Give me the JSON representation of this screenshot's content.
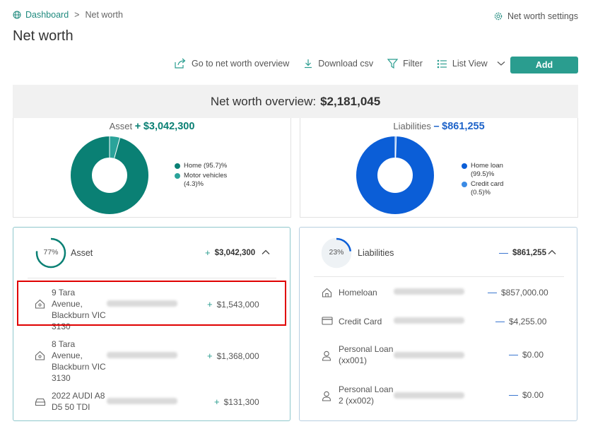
{
  "breadcrumb": {
    "root": "Dashboard",
    "separator": ">",
    "current": "Net worth"
  },
  "header": {
    "title": "Net worth",
    "settings_label": "Net worth settings"
  },
  "toolbar": {
    "overview_label": "Go to net worth overview",
    "download_label": "Download csv",
    "filter_label": "Filter",
    "view_label": "List View",
    "add_label": "Add"
  },
  "overview": {
    "label": "Net worth overview:",
    "value": "$2,181,045"
  },
  "colors": {
    "teal": "#0a8074",
    "teal_light": "#2aa39a",
    "blue": "#0b5ed7",
    "blue_light": "#3b8be5",
    "accent": "#2a9d8f"
  },
  "asset_chart": {
    "label": "Asset",
    "sign": "+",
    "amount": "$3,042,300",
    "legend": [
      "Home (95.7)%",
      "Motor vehicles (4.3)%"
    ]
  },
  "liability_chart": {
    "label": "Liabilities",
    "sign": "–",
    "amount": "$861,255",
    "legend": [
      "Home loan (99.5)%",
      "Credit card (0.5)%"
    ]
  },
  "chart_data": [
    {
      "type": "pie",
      "categories": [
        "Home",
        "Motor vehicles"
      ],
      "values": [
        95.7,
        4.3
      ]
    },
    {
      "type": "pie",
      "categories": [
        "Home loan",
        "Credit card"
      ],
      "values": [
        99.5,
        0.5
      ]
    }
  ],
  "asset_panel": {
    "percent": "77%",
    "percent_value": 77,
    "label": "Asset",
    "sign": "+",
    "total": "$3,042,300",
    "rows": [
      {
        "name": "9 Tara Avenue, Blackburn VIC 3130",
        "amount": "$1,543,000",
        "sign": "+",
        "icon": "house-icon"
      },
      {
        "name": "8 Tara Avenue, Blackburn VIC 3130",
        "amount": "$1,368,000",
        "sign": "+",
        "icon": "house-icon"
      },
      {
        "name": "2022 AUDI A8 D5 50 TDI",
        "amount": "$131,300",
        "sign": "+",
        "icon": "car-icon"
      }
    ]
  },
  "liability_panel": {
    "percent": "23%",
    "percent_value": 23,
    "label": "Liabilities",
    "sign": "—",
    "total": "$861,255",
    "rows": [
      {
        "name": "Homeloan",
        "amount": "$857,000.00",
        "sign": "—",
        "icon": "house-icon"
      },
      {
        "name": "Credit Card",
        "amount": "$4,255.00",
        "sign": "—",
        "icon": "credit-card-icon"
      },
      {
        "name": "Personal Loan (xx001)",
        "amount": "$0.00",
        "sign": "—",
        "icon": "person-icon"
      },
      {
        "name": "Personal Loan 2 (xx002)",
        "amount": "$0.00",
        "sign": "—",
        "icon": "person-icon"
      }
    ]
  }
}
